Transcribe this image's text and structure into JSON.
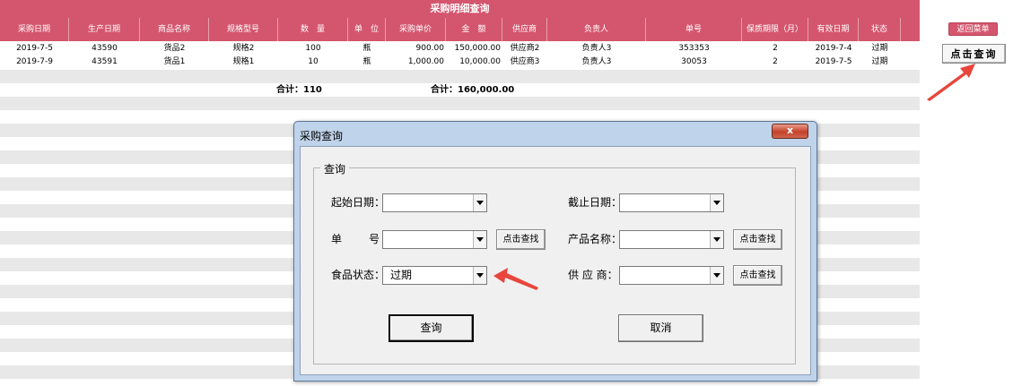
{
  "sheet": {
    "title": "采购明细查询",
    "columns": [
      "采购日期",
      "生产日期",
      "商品名称",
      "规格型号",
      "数　量",
      "单　位",
      "采购单价",
      "金　额",
      "供应商",
      "负责人",
      "单号",
      "保质期限（月）",
      "有效日期",
      "状态"
    ],
    "rows": [
      [
        "2019-7-5",
        "43590",
        "货品2",
        "规格2",
        "100",
        "瓶",
        "900.00",
        "150,000.00",
        "供应商2",
        "负责人3",
        "353353",
        "2",
        "2019-7-4",
        "过期"
      ],
      [
        "2019-7-9",
        "43591",
        "货品1",
        "规格1",
        "10",
        "瓶",
        "1,000.00",
        "10,000.00",
        "供应商3",
        "负责人3",
        "30053",
        "2",
        "2019-7-5",
        "过期"
      ]
    ],
    "total_qty": "合计：110",
    "total_amount": "合计：160,000.00",
    "header_color": "#d4566e"
  },
  "side": {
    "return_label": "返回菜单",
    "click_query_label": "点击查询"
  },
  "dialog": {
    "title": "采购查询",
    "close_label": "x",
    "group_label": "查询",
    "start_date_label": "起始日期：",
    "start_date_value": "",
    "end_date_label": "截止日期：",
    "end_date_value": "",
    "order_no_label_a": "单",
    "order_no_label_b": "号",
    "order_no_value": "",
    "product_name_label": "产品名称：",
    "product_name_value": "",
    "food_status_label": "食品状态：",
    "food_status_value": "过期",
    "supplier_label": "供 应 商：",
    "supplier_value": "",
    "find_label": "点击查找",
    "query_label": "查询",
    "cancel_label": "取消"
  },
  "colors": {
    "accent": "#d4566e",
    "annotation_arrow": "#e8453c",
    "dialog_frame": "#bfd3ea"
  }
}
